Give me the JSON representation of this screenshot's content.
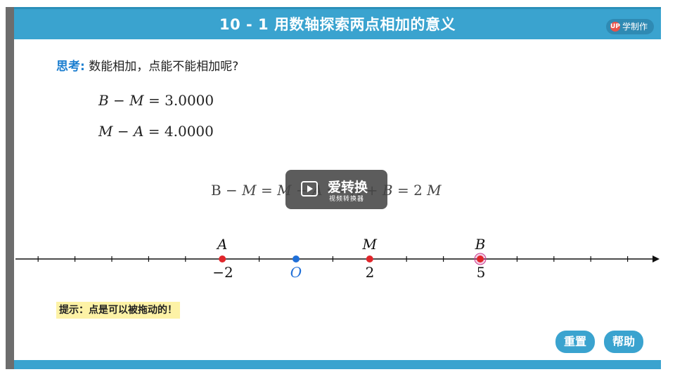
{
  "header": {
    "title": "10 - 1 用数轴探索两点相加的意义",
    "logo_mark": "UP",
    "logo_text": "学制作"
  },
  "prompt": {
    "label": "思考:",
    "text": "数能相加，点能不能相加呢?"
  },
  "equations": [
    {
      "lhs": "B − M",
      "op": "=",
      "value": "3.0000"
    },
    {
      "lhs": "M − A",
      "op": "=",
      "value": "4.0000"
    }
  ],
  "center_equation": {
    "p1": "B − ",
    "p2": "M",
    "p3": " = ",
    "p4": "M",
    "p5": " − ",
    "p6": "A",
    "p7": " ⟹ ",
    "p8": "A",
    "p9": " + ",
    "p10": "B",
    "p11": " = 2 ",
    "p12": "M"
  },
  "watermark": {
    "title": "爱转换",
    "subtitle": "视频转换器"
  },
  "number_line": {
    "points": [
      {
        "name": "A",
        "value": -2,
        "color": "#e0262b"
      },
      {
        "name": "O",
        "value": 0,
        "color": "#1f6fd8"
      },
      {
        "name": "M",
        "value": 2,
        "color": "#e0262b"
      },
      {
        "name": "B",
        "value": 5,
        "color": "#e0262b"
      }
    ],
    "tick_labels": [
      "−2",
      "2",
      "5"
    ]
  },
  "hint": {
    "text": "提示：点是可以被拖动的！"
  },
  "buttons": {
    "reset": "重置",
    "help": "帮助"
  }
}
